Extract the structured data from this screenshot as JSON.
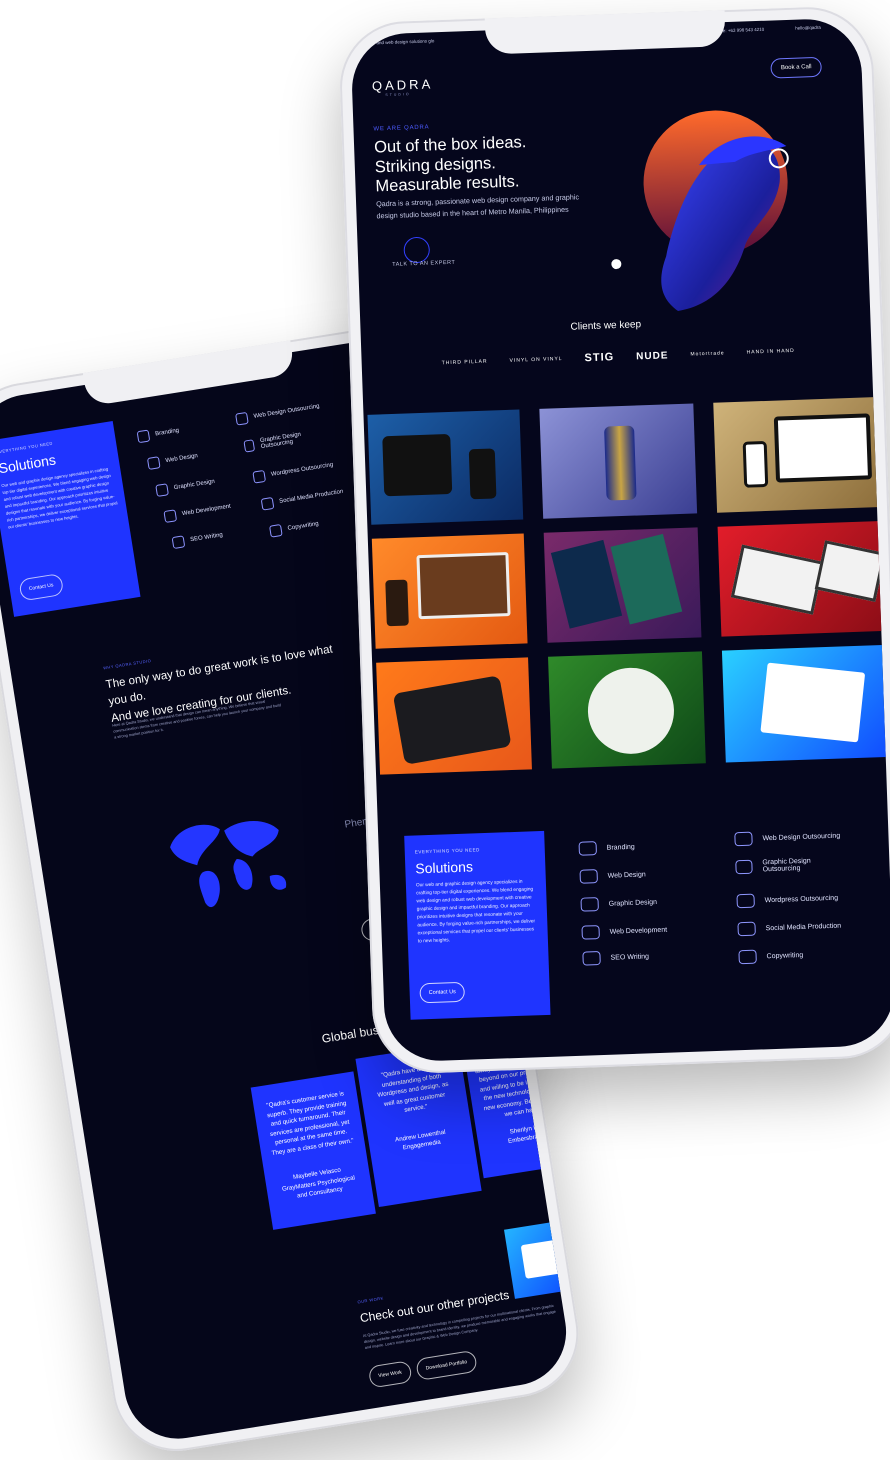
{
  "front": {
    "topbar_left": "graphic and web design solutions glo",
    "topbar_right": "de: +63 998 543 4210",
    "topbar_email": "hello@qadra",
    "logo": "QADRA",
    "logo_sub": "STUDIO",
    "book_label": "Book a Call",
    "hero": {
      "eyebrow": "WE ARE QADRA",
      "headline_1": "Out of the box ideas.",
      "headline_2": "Striking designs.",
      "headline_3": "Measurable results.",
      "description": "Qadra is a strong, passionate web design company and graphic design studio based in the heart of Metro Manila, Philippines",
      "cta": "TALK TO AN EXPERT"
    },
    "clients_title": "Clients we keep",
    "client_logos": [
      "THIRD PILLAR",
      "VINYL ON VINYL",
      "STIG",
      "NUDE",
      "Motortrade",
      "HAND IN HAND"
    ],
    "solutions": {
      "eyebrow": "EVERYTHING YOU NEED",
      "title": "Solutions",
      "body": "Our web and graphic design agency specializes in crafting top-tier digital experiences. We blend engaging web design and robust web development with creative graphic design and impactful branding. Our approach prioritizes intuitive designs that resonate with your audience. By forging value-rich partnerships, we deliver exceptional services that propel our clients' businesses to new heights.",
      "button": "Contact Us"
    },
    "services_left": [
      "Branding",
      "Web Design",
      "Graphic Design",
      "Web Development",
      "SEO Writing"
    ],
    "services_right": [
      "Web Design Outsourcing",
      "Graphic Design Outsourcing",
      "Wordpress Outsourcing",
      "Social Media Production",
      "Copywriting"
    ]
  },
  "back": {
    "solutions": {
      "eyebrow": "EVERYTHING YOU NEED",
      "title": "Solutions",
      "body": "Our web and graphic design agency specializes in crafting top-tier digital experiences. We blend engaging web design and robust web development with creative graphic design and impactful branding. Our approach prioritizes intuitive designs that resonate with your audience. By forging value-rich partnerships, we deliver exceptional services that propel our clients' businesses to new heights.",
      "button": "Contact Us"
    },
    "services_left": [
      "Branding",
      "Web Design",
      "Graphic Design",
      "Web Development",
      "SEO Writing"
    ],
    "services_right": [
      "Web Design Outsourcing",
      "Graphic Design Outsourcing",
      "Wordpress Outsourcing",
      "Social Media Production",
      "Copywriting"
    ],
    "why": {
      "eyebrow": "WHY QADRA STUDIO",
      "headline_1": "The only way to do great work is to love what you do.",
      "headline_2": "And we love creating for our clients.",
      "body": "Here at Qadra Studio, we understand that design can mean anything. We believe that visual communication stems from creative and positive forces, can help you launch your company and build a strong market position for it."
    },
    "phenomenal": "Phenome spannin",
    "view_all": "View al",
    "global_title": "Global businesses lo",
    "testimonials": [
      {
        "quote": "\"Qadra's customer service is superb. They provide training and quick turnaround. Their services are professional, yet personal at the same time. They are a class of their own.\"",
        "name": "Maybelle Velasco",
        "company": "GrayMatters Psychological and Consultancy"
      },
      {
        "quote": "\"Qadra have a strong understanding of both Wordpress and design, as well as great customer service.\"",
        "name": "Andrew Lowenthal",
        "company": "Engagemedia"
      },
      {
        "quote": "\"Fantastic all round service provided by the team. Extremely responsive and always willing to go above and beyond on our projects. Able and willing to be in front of all the new technologies in the new economy. Best partners we can have!\"",
        "name": "Sherilyn Lim",
        "company": "Embersbrands"
      }
    ],
    "projects": {
      "eyebrow": "OUR WORK",
      "title": "Check out our other projects",
      "body": "At Qadra Studio, we fuse creativity and technology in compelling projects for our multinational clients. From graphic design, website design and development to brand identity, we produce memorable and engaging works that engage and inspire. Learn more about our Graphic & Web Design Company.",
      "view_work": "View Work",
      "download": "Download Portfolio"
    }
  },
  "colors": {
    "accent_blue": "#1f34ff",
    "screen_bg": "#05061c",
    "phone_frame": "#f1f1f4"
  }
}
